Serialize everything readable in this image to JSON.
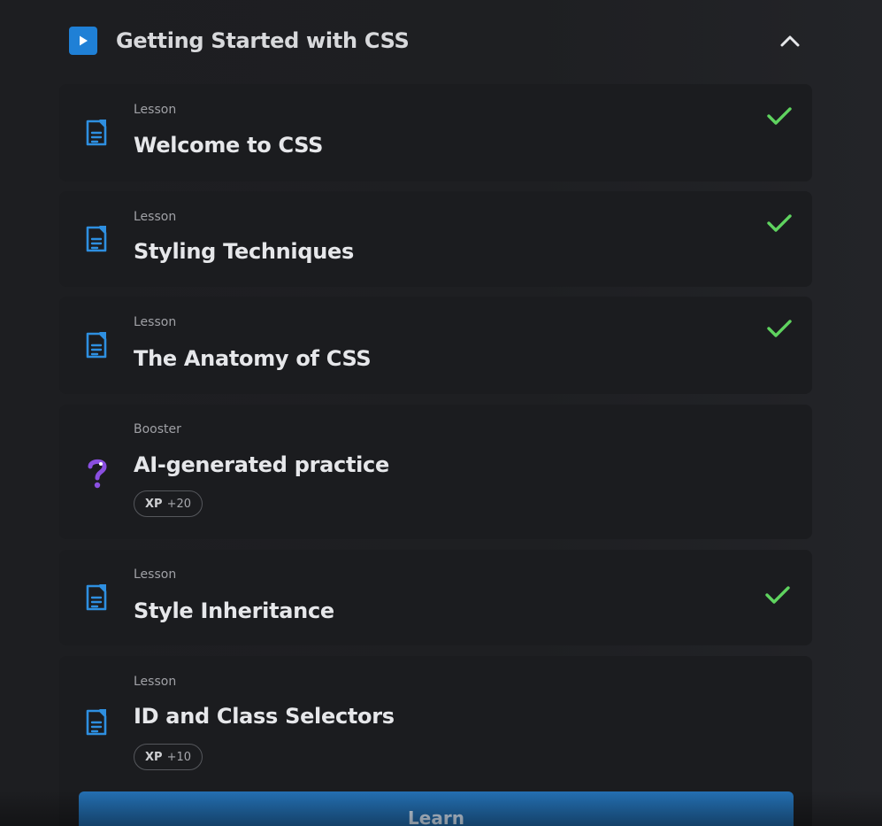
{
  "module": {
    "title": "Getting Started with CSS",
    "icon": "play-icon",
    "collapse_icon": "chevron-up-icon"
  },
  "items": [
    {
      "kind": "Lesson",
      "title": "Welcome to CSS",
      "icon": "lesson-document-icon",
      "completed": true
    },
    {
      "kind": "Lesson",
      "title": "Styling Techniques",
      "icon": "lesson-document-icon",
      "completed": true
    },
    {
      "kind": "Lesson",
      "title": "The Anatomy of CSS",
      "icon": "lesson-document-icon",
      "completed": true
    },
    {
      "kind": "Booster",
      "title": "AI-generated practice",
      "icon": "question-mark-icon",
      "completed": false,
      "xp_label": "XP",
      "xp_value": "+20"
    },
    {
      "kind": "Lesson",
      "title": "Style Inheritance",
      "icon": "lesson-document-icon",
      "completed": true
    },
    {
      "kind": "Lesson",
      "title": "ID and Class Selectors",
      "icon": "lesson-document-icon",
      "completed": false,
      "xp_label": "XP",
      "xp_value": "+10"
    }
  ],
  "learn_button": {
    "label": "Learn"
  },
  "colors": {
    "accent": "#1f80d6",
    "check": "#5fd35f",
    "booster": "#8a4fe0",
    "card_bg": "#1b1c1f"
  }
}
